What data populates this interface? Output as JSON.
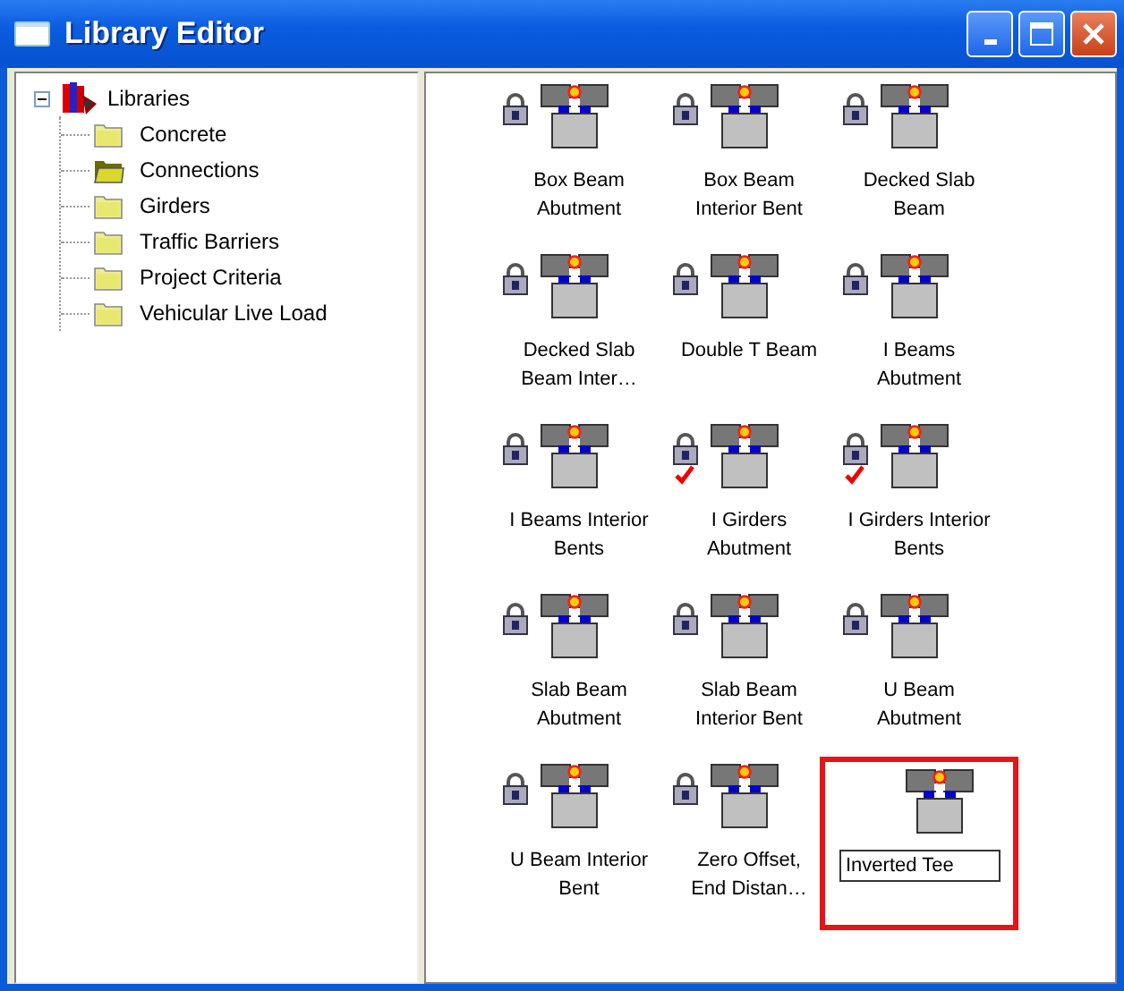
{
  "window": {
    "title": "Library Editor"
  },
  "tree": {
    "label": "Libraries",
    "expanded": true,
    "children": [
      {
        "label": "Concrete",
        "open": false
      },
      {
        "label": "Connections",
        "open": true
      },
      {
        "label": "Girders",
        "open": false
      },
      {
        "label": "Traffic Barriers",
        "open": false
      },
      {
        "label": "Project Criteria",
        "open": false
      },
      {
        "label": "Vehicular Live Load",
        "open": false
      }
    ]
  },
  "entries": [
    {
      "label": "Box Beam Abutment",
      "locked": true,
      "checked": false,
      "editing": false,
      "highlighted": false
    },
    {
      "label": "Box Beam Interior Bent",
      "locked": true,
      "checked": false,
      "editing": false,
      "highlighted": false
    },
    {
      "label": "Decked Slab Beam",
      "locked": true,
      "checked": false,
      "editing": false,
      "highlighted": false
    },
    {
      "label": "Decked Slab Beam Inter…",
      "locked": true,
      "checked": false,
      "editing": false,
      "highlighted": false
    },
    {
      "label": "Double T Beam",
      "locked": true,
      "checked": false,
      "editing": false,
      "highlighted": false
    },
    {
      "label": "I Beams Abutment",
      "locked": true,
      "checked": false,
      "editing": false,
      "highlighted": false
    },
    {
      "label": "I Beams Interior Bents",
      "locked": true,
      "checked": false,
      "editing": false,
      "highlighted": false
    },
    {
      "label": "I Girders Abutment",
      "locked": true,
      "checked": true,
      "editing": false,
      "highlighted": false
    },
    {
      "label": "I Girders Interior Bents",
      "locked": true,
      "checked": true,
      "editing": false,
      "highlighted": false
    },
    {
      "label": "Slab Beam Abutment",
      "locked": true,
      "checked": false,
      "editing": false,
      "highlighted": false
    },
    {
      "label": "Slab Beam Interior Bent",
      "locked": true,
      "checked": false,
      "editing": false,
      "highlighted": false
    },
    {
      "label": "U Beam Abutment",
      "locked": true,
      "checked": false,
      "editing": false,
      "highlighted": false
    },
    {
      "label": "U Beam Interior Bent",
      "locked": true,
      "checked": false,
      "editing": false,
      "highlighted": false
    },
    {
      "label": "Zero Offset, End Distan…",
      "locked": true,
      "checked": false,
      "editing": false,
      "highlighted": false
    },
    {
      "label": "Inverted Tee",
      "locked": false,
      "checked": false,
      "editing": true,
      "highlighted": true
    }
  ]
}
